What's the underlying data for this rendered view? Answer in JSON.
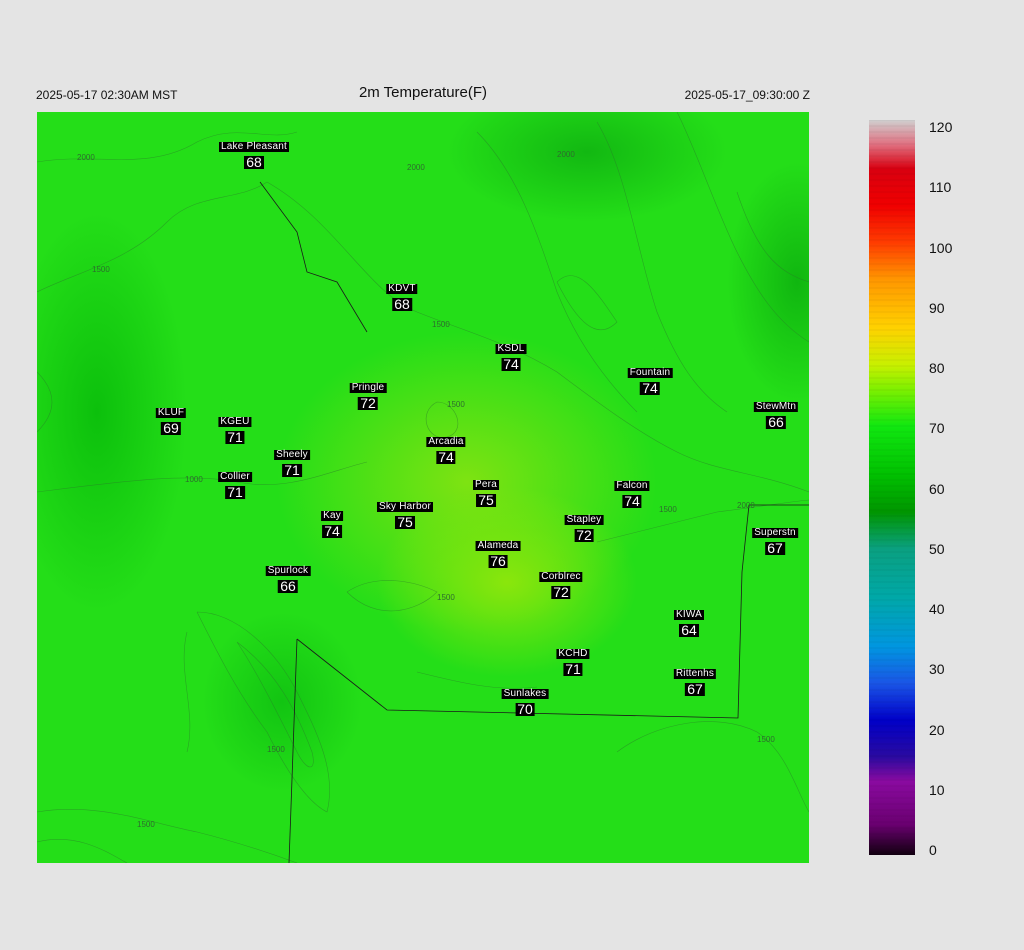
{
  "header": {
    "title": "2m Temperature(F)",
    "local_time": "2025-05-17 02:30AM MST",
    "utc_time": "2025-05-17_09:30:00 Z"
  },
  "stations": [
    {
      "id": "lake-pleasant",
      "name": "Lake Pleasant",
      "value": "68"
    },
    {
      "id": "kdvt",
      "name": "KDVT",
      "value": "68"
    },
    {
      "id": "ksdl",
      "name": "KSDL",
      "value": "74"
    },
    {
      "id": "fountain",
      "name": "Fountain",
      "value": "74"
    },
    {
      "id": "pringle",
      "name": "Pringle",
      "value": "72"
    },
    {
      "id": "stewmtn",
      "name": "StewMtn",
      "value": "66"
    },
    {
      "id": "kluf",
      "name": "KLUF",
      "value": "69"
    },
    {
      "id": "kgeu",
      "name": "KGEU",
      "value": "71"
    },
    {
      "id": "arcadia",
      "name": "Arcadia",
      "value": "74"
    },
    {
      "id": "sheely",
      "name": "Sheely",
      "value": "71"
    },
    {
      "id": "collier",
      "name": "Collier",
      "value": "71"
    },
    {
      "id": "pera",
      "name": "Pera",
      "value": "75"
    },
    {
      "id": "falcon",
      "name": "Falcon",
      "value": "74"
    },
    {
      "id": "sky-harbor",
      "name": "Sky Harbor",
      "value": "75"
    },
    {
      "id": "kay",
      "name": "Kay",
      "value": "74"
    },
    {
      "id": "stapley",
      "name": "Stapley",
      "value": "72"
    },
    {
      "id": "superstn",
      "name": "Superstn",
      "value": "67"
    },
    {
      "id": "alameda",
      "name": "Alameda",
      "value": "76"
    },
    {
      "id": "spurlock",
      "name": "Spurlock",
      "value": "66"
    },
    {
      "id": "corblrec",
      "name": "Corblrec",
      "value": "72"
    },
    {
      "id": "kiwa",
      "name": "KIWA",
      "value": "64"
    },
    {
      "id": "kchd",
      "name": "KCHD",
      "value": "71"
    },
    {
      "id": "rittenhs",
      "name": "Rittenhs",
      "value": "67"
    },
    {
      "id": "sunlakes",
      "name": "Sunlakes",
      "value": "70"
    }
  ],
  "contour_labels": [
    "2000",
    "2000",
    "2000",
    "1500",
    "1500",
    "1500",
    "1000",
    "1500",
    "2000",
    "1500",
    "1500",
    "1500",
    "1500"
  ],
  "colorbar": {
    "min": 0,
    "max": 120,
    "tick_labels": [
      "120",
      "110",
      "100",
      "90",
      "80",
      "70",
      "60",
      "50",
      "40",
      "30",
      "20",
      "10",
      "0"
    ],
    "stops": [
      {
        "v": 0,
        "color": "#120010"
      },
      {
        "v": 5,
        "color": "#6a0070"
      },
      {
        "v": 12,
        "color": "#8a0aa0"
      },
      {
        "v": 16,
        "color": "#2a0aa0"
      },
      {
        "v": 22,
        "color": "#0000c8"
      },
      {
        "v": 28,
        "color": "#1a55e6"
      },
      {
        "v": 34,
        "color": "#0096e0"
      },
      {
        "v": 42,
        "color": "#00a8a8"
      },
      {
        "v": 50,
        "color": "#0aa080"
      },
      {
        "v": 56,
        "color": "#009600"
      },
      {
        "v": 62,
        "color": "#00c000"
      },
      {
        "v": 70,
        "color": "#10e810"
      },
      {
        "v": 76,
        "color": "#7ef000"
      },
      {
        "v": 80,
        "color": "#c8f000"
      },
      {
        "v": 86,
        "color": "#ffd200"
      },
      {
        "v": 94,
        "color": "#ff9600"
      },
      {
        "v": 100,
        "color": "#ff3c00"
      },
      {
        "v": 106,
        "color": "#f00000"
      },
      {
        "v": 112,
        "color": "#d80010"
      },
      {
        "v": 116,
        "color": "#e07080"
      },
      {
        "v": 120,
        "color": "#cfcfcf"
      }
    ]
  }
}
